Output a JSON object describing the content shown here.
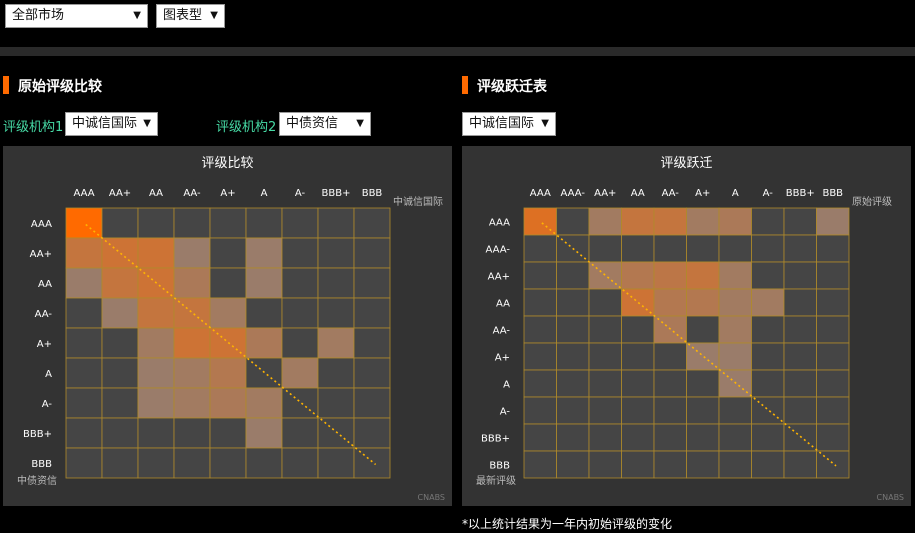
{
  "filters": {
    "market": "全部市场",
    "view": "图表型"
  },
  "colors": {
    "accent": "#ff6a00",
    "agency_label": "#46d9a4",
    "panel_bg": "#333333",
    "cell_empty": "#454545",
    "grid_line": "#b08a2a",
    "diagonal": "#ffb400"
  },
  "sections": {
    "compare_title": "原始评级比较",
    "migration_title": "评级跃迁表"
  },
  "agencies": {
    "label1": "评级机构1",
    "value1": "中诚信国际",
    "label2": "评级机构2",
    "value2": "中债资信",
    "migration_value": "中诚信国际"
  },
  "watermark": "CNABS",
  "footnote": "*以上统计结果为一年内初始评级的变化",
  "chart_data": [
    {
      "type": "heatmap",
      "title": "评级比较",
      "x_axis_label": "中诚信国际",
      "y_axis_label": "中债资信",
      "x_categories": [
        "AAA",
        "AA+",
        "AA",
        "AA-",
        "A+",
        "A",
        "A-",
        "BBB+",
        "BBB"
      ],
      "y_categories": [
        "AAA",
        "AA+",
        "AA",
        "AA-",
        "A+",
        "A",
        "A-",
        "BBB+",
        "BBB"
      ],
      "diagonal_line": true,
      "intensity": [
        [
          1.0,
          0,
          0,
          0,
          0,
          0,
          0,
          0,
          0
        ],
        [
          0.65,
          0.7,
          0.7,
          0.4,
          0,
          0.4,
          0,
          0,
          0
        ],
        [
          0.4,
          0.65,
          0.7,
          0.5,
          0,
          0.4,
          0,
          0,
          0
        ],
        [
          0,
          0.4,
          0.65,
          0.65,
          0.45,
          0,
          0,
          0,
          0
        ],
        [
          0,
          0,
          0.45,
          0.7,
          0.7,
          0.5,
          0,
          0.45,
          0
        ],
        [
          0,
          0,
          0.4,
          0.45,
          0.55,
          0,
          0.45,
          0,
          0
        ],
        [
          0,
          0,
          0.4,
          0.45,
          0.5,
          0.45,
          0,
          0,
          0
        ],
        [
          0,
          0,
          0,
          0,
          0,
          0.4,
          0,
          0,
          0
        ],
        [
          0,
          0,
          0,
          0,
          0,
          0,
          0,
          0,
          0
        ]
      ]
    },
    {
      "type": "heatmap",
      "title": "评级跃迁",
      "x_axis_label": "原始评级",
      "y_axis_label": "最新评级",
      "x_categories": [
        "AAA",
        "AAA-",
        "AA+",
        "AA",
        "AA-",
        "A+",
        "A",
        "A-",
        "BBB+",
        "BBB"
      ],
      "y_categories": [
        "AAA",
        "AAA-",
        "AA+",
        "AA",
        "AA-",
        "A+",
        "A",
        "A-",
        "BBB+",
        "BBB"
      ],
      "diagonal_line": true,
      "intensity": [
        [
          0.8,
          0,
          0.45,
          0.65,
          0.65,
          0.45,
          0.5,
          0,
          0,
          0.4
        ],
        [
          0,
          0,
          0,
          0,
          0,
          0,
          0,
          0,
          0,
          0
        ],
        [
          0,
          0,
          0.45,
          0.55,
          0.6,
          0.65,
          0.45,
          0,
          0,
          0
        ],
        [
          0,
          0,
          0,
          0.7,
          0.55,
          0.55,
          0.45,
          0.45,
          0,
          0
        ],
        [
          0,
          0,
          0,
          0,
          0.5,
          0,
          0.45,
          0,
          0,
          0
        ],
        [
          0,
          0,
          0,
          0,
          0,
          0.4,
          0.4,
          0,
          0,
          0
        ],
        [
          0,
          0,
          0,
          0,
          0,
          0,
          0.4,
          0,
          0,
          0
        ],
        [
          0,
          0,
          0,
          0,
          0,
          0,
          0,
          0,
          0,
          0
        ],
        [
          0,
          0,
          0,
          0,
          0,
          0,
          0,
          0,
          0,
          0
        ],
        [
          0,
          0,
          0,
          0,
          0,
          0,
          0,
          0,
          0,
          0
        ]
      ]
    }
  ]
}
